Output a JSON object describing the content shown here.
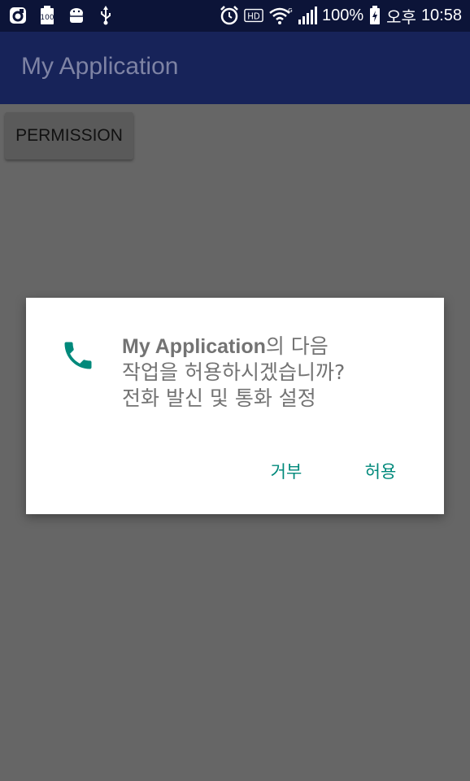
{
  "status_bar": {
    "battery_percent": "100%",
    "ampm": "오후",
    "time": "10:58",
    "icons_left": [
      "app-notification-icon",
      "battery-saver-icon",
      "android-debug-icon",
      "usb-icon"
    ],
    "icons_right": [
      "alarm-icon",
      "hd-icon",
      "wifi-icon",
      "signal-icon",
      "battery-charging-icon"
    ]
  },
  "app_bar": {
    "title": "My Application"
  },
  "main": {
    "permission_button": "PERMISSION"
  },
  "dialog": {
    "icon": "phone-icon",
    "app_name": "My Application",
    "line1_suffix": "의 다음",
    "line2": "작업을 허용하시겠습니까?",
    "line3": "전화 발신 및 통화 설정",
    "deny_label": "거부",
    "allow_label": "허용"
  },
  "colors": {
    "status_bar": "#0c1438",
    "app_bar": "#172359",
    "scrim": "#666666",
    "accent": "#00897b"
  }
}
